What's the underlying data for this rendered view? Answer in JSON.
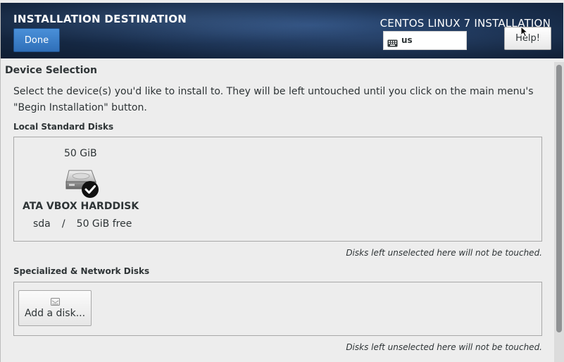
{
  "header": {
    "title": "INSTALLATION DESTINATION",
    "done_label": "Done",
    "product_title": "CENTOS LINUX 7 INSTALLATION",
    "keyboard_layout": "us",
    "help_label": "Help!"
  },
  "device_selection": {
    "heading": "Device Selection",
    "instruction": "Select the device(s) you'd like to install to.  They will be left untouched until you click on the main menu's \"Begin Installation\" button."
  },
  "local_disks": {
    "label": "Local Standard Disks",
    "disks": [
      {
        "size": "50 GiB",
        "name": "ATA VBOX HARDDISK",
        "device": "sda",
        "separator": "/",
        "free": "50 GiB free",
        "selected": true,
        "icon": "harddisk-icon"
      }
    ],
    "note": "Disks left unselected here will not be touched."
  },
  "specialized_disks": {
    "label": "Specialized & Network Disks",
    "add_label": "Add a disk...",
    "note": "Disks left unselected here will not be touched."
  },
  "colors": {
    "done_button": "#3b7fc9",
    "header_bg": "#1d3558",
    "page_bg": "#ededed"
  }
}
